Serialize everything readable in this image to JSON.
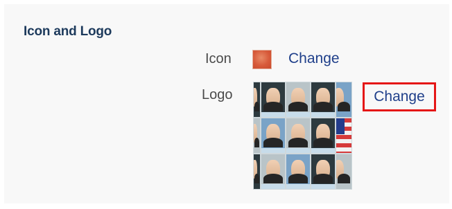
{
  "section": {
    "title": "Icon and Logo"
  },
  "icon_row": {
    "label": "Icon",
    "change_label": "Change"
  },
  "logo_row": {
    "label": "Logo",
    "change_label": "Change"
  },
  "colors": {
    "title": "#1d3a5c",
    "link": "#1f3f8a",
    "highlight_border": "#e51616",
    "panel_background": "#f8f8f8"
  },
  "icons": {
    "icon_thumbnail": "orange-square-icon",
    "logo_thumbnail": "presidents-stamp-collage-image"
  }
}
